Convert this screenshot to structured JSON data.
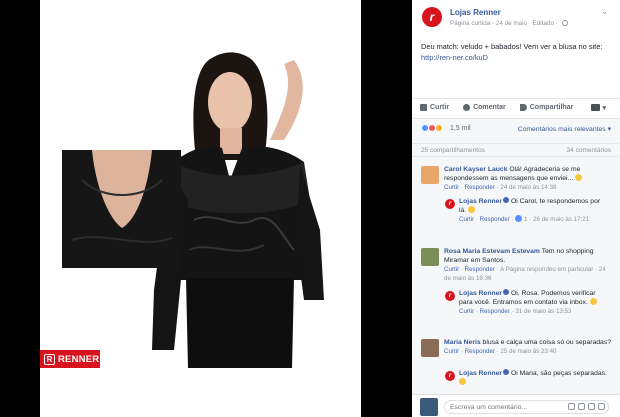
{
  "post": {
    "page_name": "Lojas Renner",
    "meta": "Página curtida · 24 de maio · Editado ·",
    "text": "Deu match: veludo + babados! Vem ver a blusa no site:",
    "link": "http://ren-ner.co/kuD",
    "menu_glyph": "⌄"
  },
  "actions": {
    "like": "Curtir",
    "comment": "Comentar",
    "share": "Compartilhar",
    "audience_caret": "▾"
  },
  "reactions": {
    "count": "1,5 mil",
    "sort": "Comentários mais relevantes ▾",
    "shares": "25 compartilhamentos",
    "comments": "34 comentários"
  },
  "photo": {
    "brand": "RENNER",
    "brand_mark": "R",
    "colors": {
      "brand_red": "#d7141d",
      "velvet": "#141414"
    }
  },
  "comments": [
    {
      "author": "Carol Kayser Lauck",
      "text": "Olá! Agradeceria se me respondessem as mensagens que enviei...",
      "like": "Curtir",
      "reply": "Responder",
      "time": "24 de maio às 14:38"
    },
    {
      "author": "Lojas Renner",
      "text": "Oi Carol, te respondemos por lá.",
      "like": "Curtir",
      "reply": "Responder",
      "likes": "1",
      "time": "26 de maio às 17:21"
    },
    {
      "author": "Rosa Maria Estevam Estevam",
      "text": "Tem no shopping Miramar em Santos.",
      "like": "Curtir",
      "reply": "Responder",
      "extra": "A Página respondeu em particular",
      "time": "24 de maio às 16:36"
    },
    {
      "author": "Lojas Renner",
      "text": "Oi, Rosa. Podemos verificar para você. Entramos em contato via inbox.",
      "like": "Curtir",
      "reply": "Responder",
      "time": "31 de maio às 13:53"
    },
    {
      "author": "Maria Neris",
      "text": "blusa e calça uma coisa só ou separadas?",
      "like": "Curtir",
      "reply": "Responder",
      "time": "25 de maio às 23:40"
    },
    {
      "author": "Lojas Renner",
      "text": "Oi Maria, são peças separadas."
    }
  ],
  "composer": {
    "placeholder": "Escreva um comentário..."
  }
}
